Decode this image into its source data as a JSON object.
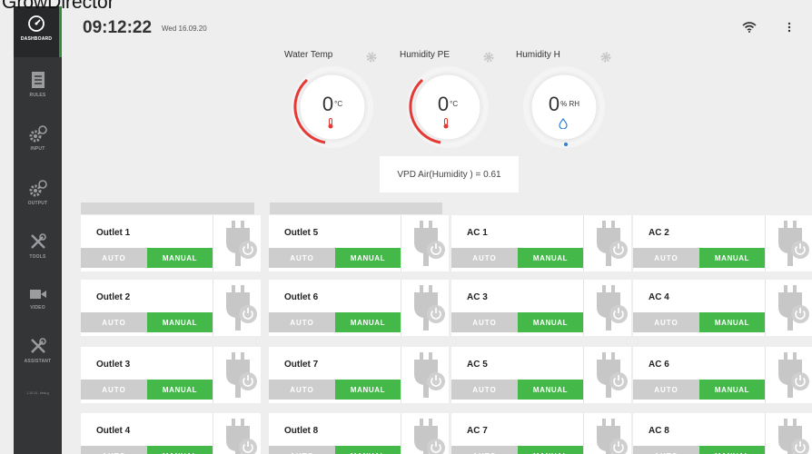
{
  "caption": "GrowDirector",
  "sidebar": {
    "items": [
      {
        "label": "DASHBOARD",
        "icon": "speedometer-icon",
        "active": true
      },
      {
        "label": "RULES",
        "icon": "document-icon",
        "active": false
      },
      {
        "label": "INPUT",
        "icon": "gears-icon",
        "active": false
      },
      {
        "label": "OUTPUT",
        "icon": "gears-icon",
        "active": false
      },
      {
        "label": "TOOLS",
        "icon": "tools-icon",
        "active": false
      },
      {
        "label": "VIDEO",
        "icon": "camera-icon",
        "active": false
      },
      {
        "label": "ASSISTANT",
        "icon": "tools-icon",
        "active": false
      }
    ],
    "version": "1.10.15 - beta.g"
  },
  "header": {
    "time": "09:12:22",
    "date": "Wed 16.09.20",
    "wifi_icon": "wifi-icon",
    "menu_icon": "kebab-menu-icon"
  },
  "gauges": [
    {
      "label": "Water Temp",
      "value": "0",
      "unit": "°C",
      "icon": "thermometer-icon",
      "accent": "#e53935"
    },
    {
      "label": "Humidity PE",
      "value": "0",
      "unit": "°C",
      "icon": "thermometer-icon",
      "accent": "#e53935"
    },
    {
      "label": "Humidity H",
      "value": "0",
      "unit": "% RH",
      "icon": "droplet-icon",
      "accent": "#2a7fd6"
    }
  ],
  "vpd": "VPD Air(Humidity ) = 0.61",
  "outlets": {
    "auto_label": "AUTO",
    "manual_label": "MANUAL",
    "columns": [
      [
        "Outlet 1",
        "Outlet 2",
        "Outlet 3",
        "Outlet 4"
      ],
      [
        "Outlet 5",
        "Outlet 6",
        "Outlet 7",
        "Outlet 8"
      ],
      [
        "AC 1",
        "AC 3",
        "AC 5",
        "AC 7"
      ],
      [
        "AC 2",
        "AC 4",
        "AC 6",
        "AC 8"
      ]
    ]
  },
  "colors": {
    "sidebar": "#333537",
    "manual_active": "#44b94a",
    "auto_inactive": "#cdcdcd",
    "active_indicator": "#2f8d3b"
  }
}
